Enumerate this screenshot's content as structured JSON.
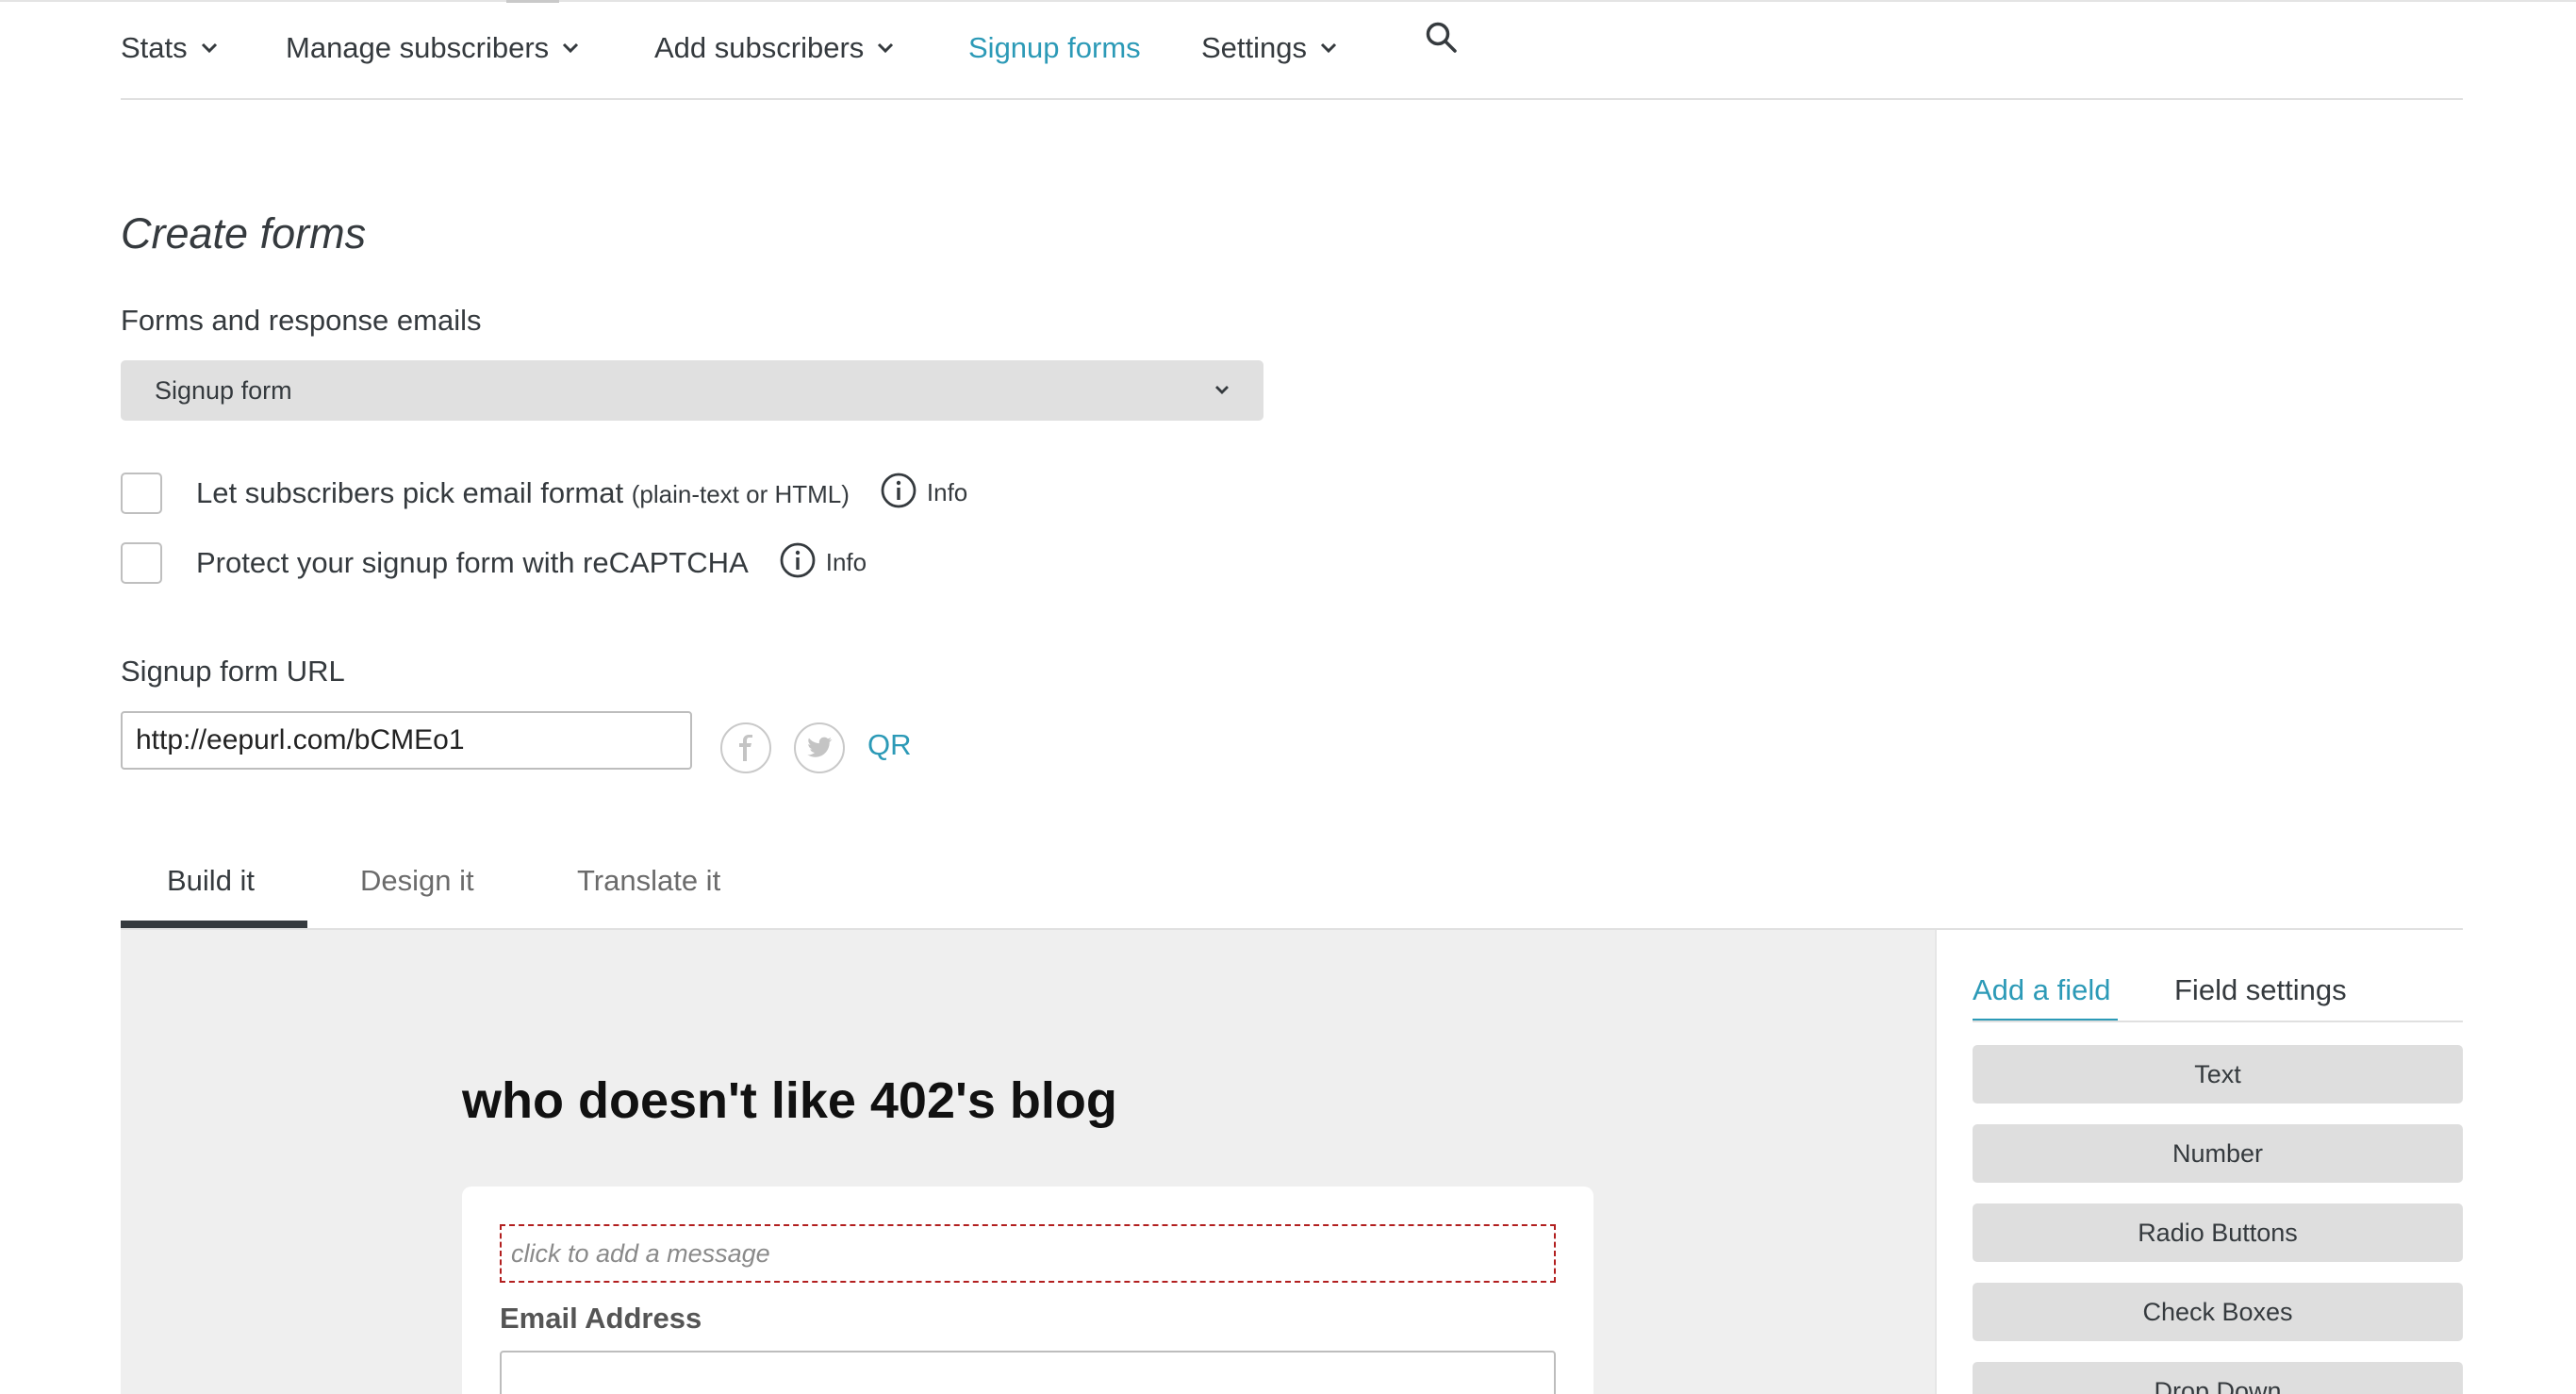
{
  "nav": {
    "items": [
      {
        "label": "Stats",
        "has_dropdown": true
      },
      {
        "label": "Manage subscribers",
        "has_dropdown": true
      },
      {
        "label": "Add subscribers",
        "has_dropdown": true
      },
      {
        "label": "Signup forms",
        "has_dropdown": false,
        "active": true
      },
      {
        "label": "Settings",
        "has_dropdown": true
      }
    ],
    "search_icon": "search-icon"
  },
  "page": {
    "title": "Create forms",
    "forms_label": "Forms and response emails",
    "form_select_value": "Signup form"
  },
  "options": [
    {
      "label": "Let subscribers pick email format",
      "note": "(plain-text or HTML)",
      "info": "Info",
      "checked": false
    },
    {
      "label": "Protect your signup form with reCAPTCHA",
      "note": "",
      "info": "Info",
      "checked": false
    }
  ],
  "signup_url": {
    "label": "Signup form URL",
    "value": "http://eepurl.com/bCMEo1",
    "share_icons": [
      "facebook-icon",
      "twitter-icon"
    ],
    "qr": "QR"
  },
  "tabs": [
    {
      "label": "Build it",
      "active": true
    },
    {
      "label": "Design it",
      "active": false
    },
    {
      "label": "Translate it",
      "active": false
    }
  ],
  "builder": {
    "form_title": "who doesn't like 402's blog",
    "message_placeholder": "click to add a message",
    "email_label": "Email Address"
  },
  "sidebar": {
    "tabs": [
      {
        "label": "Add a field",
        "active": true
      },
      {
        "label": "Field settings",
        "active": false
      }
    ],
    "field_types": [
      "Text",
      "Number",
      "Radio Buttons",
      "Check Boxes",
      "Drop Down"
    ]
  },
  "colors": {
    "accent": "#2c9ab7",
    "text": "#353a3e",
    "canvas_bg": "#efefef",
    "button_bg": "#dedede",
    "message_border": "#b21f1f"
  }
}
